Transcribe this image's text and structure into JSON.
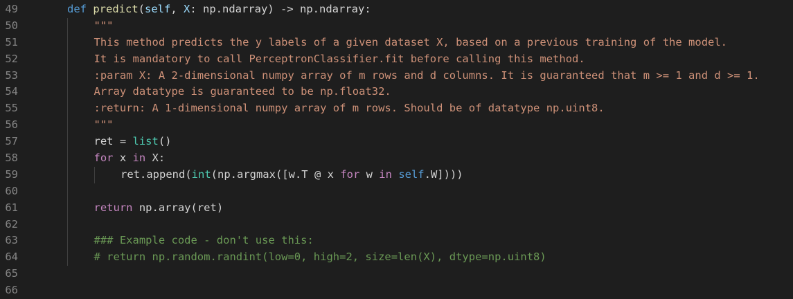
{
  "editor": {
    "lines": [
      {
        "num": "49",
        "indent": 1,
        "tokens": [
          {
            "c": "kw",
            "t": "def"
          },
          {
            "c": "plain",
            "t": " "
          },
          {
            "c": "fn",
            "t": "predict"
          },
          {
            "c": "plain",
            "t": "("
          },
          {
            "c": "param",
            "t": "self"
          },
          {
            "c": "plain",
            "t": ", "
          },
          {
            "c": "param",
            "t": "X"
          },
          {
            "c": "plain",
            "t": ": np.ndarray) -> np.ndarray:"
          }
        ]
      },
      {
        "num": "50",
        "indent": 2,
        "tokens": [
          {
            "c": "str",
            "t": "\"\"\""
          }
        ]
      },
      {
        "num": "51",
        "indent": 2,
        "tokens": [
          {
            "c": "str",
            "t": "This method predicts the y labels of a given dataset X, based on a previous training of the model."
          }
        ]
      },
      {
        "num": "52",
        "indent": 2,
        "tokens": [
          {
            "c": "str",
            "t": "It is mandatory to call PerceptronClassifier.fit before calling this method."
          }
        ]
      },
      {
        "num": "53",
        "indent": 2,
        "tokens": [
          {
            "c": "str",
            "t": ":param X: A 2-dimensional numpy array of m rows and d columns. It is guaranteed that m >= 1 and d >= 1."
          }
        ]
      },
      {
        "num": "54",
        "indent": 2,
        "tokens": [
          {
            "c": "str",
            "t": "Array datatype is guaranteed to be np.float32."
          }
        ]
      },
      {
        "num": "55",
        "indent": 2,
        "tokens": [
          {
            "c": "str",
            "t": ":return: A 1-dimensional numpy array of m rows. Should be of datatype np.uint8."
          }
        ]
      },
      {
        "num": "56",
        "indent": 2,
        "tokens": [
          {
            "c": "str",
            "t": "\"\"\""
          }
        ]
      },
      {
        "num": "57",
        "indent": 2,
        "tokens": [
          {
            "c": "plain",
            "t": "ret = "
          },
          {
            "c": "typ",
            "t": "list"
          },
          {
            "c": "plain",
            "t": "()"
          }
        ]
      },
      {
        "num": "58",
        "indent": 2,
        "tokens": [
          {
            "c": "ctl",
            "t": "for"
          },
          {
            "c": "plain",
            "t": " x "
          },
          {
            "c": "ctl",
            "t": "in"
          },
          {
            "c": "plain",
            "t": " X:"
          }
        ]
      },
      {
        "num": "59",
        "indent": 3,
        "tokens": [
          {
            "c": "plain",
            "t": "ret.append("
          },
          {
            "c": "typ",
            "t": "int"
          },
          {
            "c": "plain",
            "t": "(np.argmax([w.T @ x "
          },
          {
            "c": "ctl",
            "t": "for"
          },
          {
            "c": "plain",
            "t": " w "
          },
          {
            "c": "ctl",
            "t": "in"
          },
          {
            "c": "plain",
            "t": " "
          },
          {
            "c": "kw",
            "t": "self"
          },
          {
            "c": "plain",
            "t": ".W])))"
          }
        ]
      },
      {
        "num": "60",
        "indent": 2,
        "tokens": []
      },
      {
        "num": "61",
        "indent": 2,
        "tokens": [
          {
            "c": "ctl",
            "t": "return"
          },
          {
            "c": "plain",
            "t": " np.array(ret)"
          }
        ]
      },
      {
        "num": "62",
        "indent": 2,
        "tokens": []
      },
      {
        "num": "63",
        "indent": 2,
        "tokens": [
          {
            "c": "cmt",
            "t": "### Example code - don't use this:"
          }
        ]
      },
      {
        "num": "64",
        "indent": 2,
        "tokens": [
          {
            "c": "cmt",
            "t": "# return np.random.randint(low=0, high=2, size=len(X), dtype=np.uint8)"
          }
        ]
      },
      {
        "num": "65",
        "indent": 0,
        "tokens": []
      },
      {
        "num": "66",
        "indent": 0,
        "tokens": []
      }
    ]
  },
  "colors": {
    "background": "#1e1e1e",
    "line_number": "#858585",
    "keyword": "#569cd6",
    "control": "#c586c0",
    "function": "#dcdcaa",
    "parameter": "#9cdcfe",
    "type": "#4ec9b0",
    "string": "#ce9178",
    "comment": "#6a9955",
    "text": "#d4d4d4"
  }
}
